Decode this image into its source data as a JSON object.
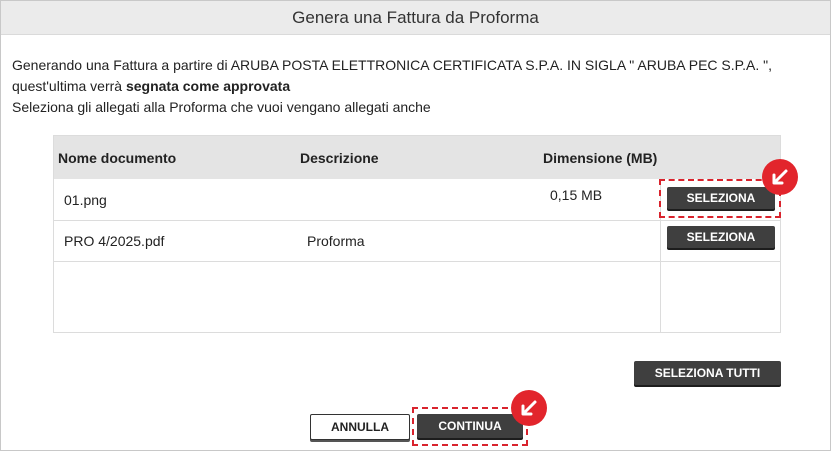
{
  "dialog": {
    "title": "Genera una Fattura da Proforma",
    "intro_line1": "Generando una Fattura a partire di ARUBA POSTA ELETTRONICA CERTIFICATA S.P.A. IN SIGLA \" ARUBA PEC S.P.A. \",",
    "intro_line2_prefix": "quest'ultima verrà ",
    "intro_line2_bold": "segnata come approvata",
    "intro_line3": "Seleziona gli allegati alla Proforma che vuoi vengano allegati anche"
  },
  "table": {
    "headers": {
      "name": "Nome documento",
      "description": "Descrizione",
      "size": "Dimensione (MB)"
    },
    "rows": [
      {
        "name": "01.png",
        "description": "",
        "size": "0,15 MB",
        "action": "SELEZIONA"
      },
      {
        "name": "PRO 4/2025.pdf",
        "description": "Proforma",
        "size": "",
        "action": "SELEZIONA"
      }
    ]
  },
  "buttons": {
    "select_all": "SELEZIONA TUTTI",
    "cancel": "ANNULLA",
    "continue": "CONTINUA"
  },
  "colors": {
    "highlight": "#d9232d",
    "button_dark": "#3f3f3f",
    "header_bg": "#e4e4e4"
  }
}
